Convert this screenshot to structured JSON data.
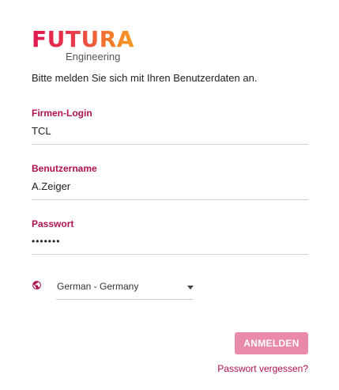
{
  "brand": {
    "name": "FUTURA",
    "subtitle": "Engineering"
  },
  "intro_text": "Bitte melden Sie sich mit Ihren Benutzerdaten an.",
  "fields": {
    "company_login": {
      "label": "Firmen-Login",
      "value": "TCL"
    },
    "username": {
      "label": "Benutzername",
      "value": "A.Zeiger"
    },
    "password": {
      "label": "Passwort",
      "value": "•••••••"
    }
  },
  "language": {
    "icon": "globe-icon",
    "selected": "German - Germany"
  },
  "login_button": "ANMELDEN",
  "forgot_password": "Passwort vergessen?",
  "colors": {
    "accent": "#b0124e",
    "button": "#e98aa8",
    "logo_start": "#e0174f",
    "logo_end": "#f79a21"
  }
}
